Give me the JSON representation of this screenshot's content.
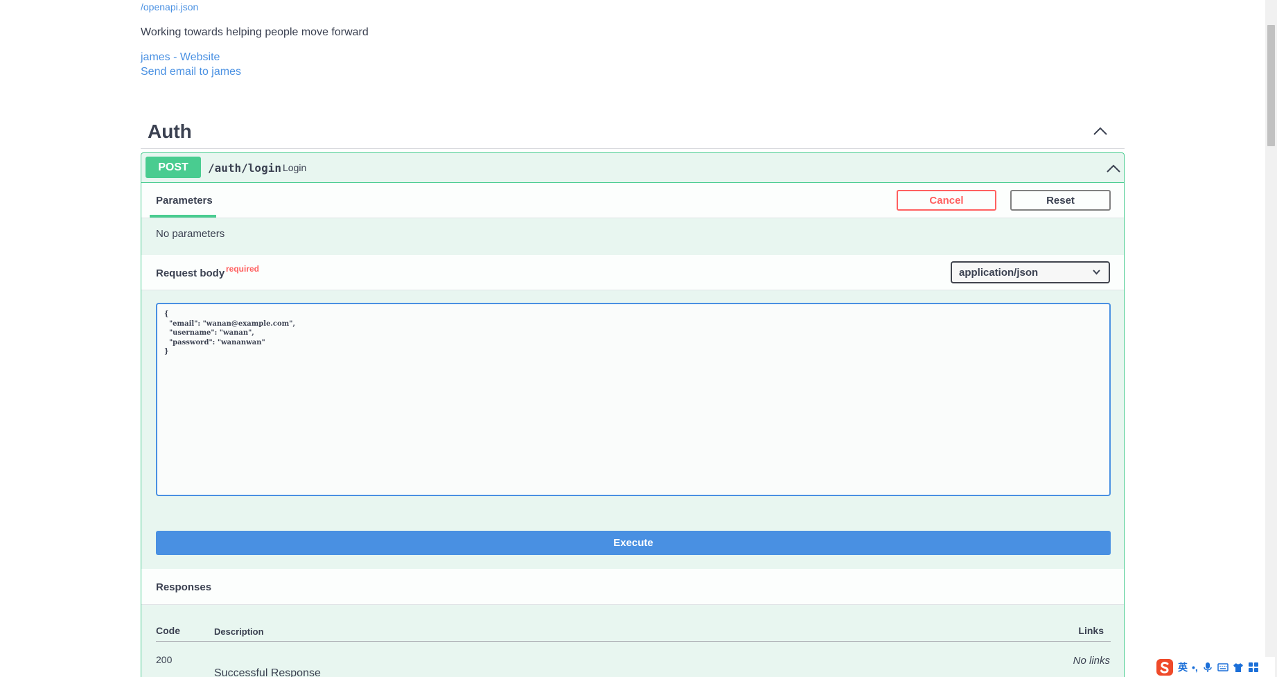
{
  "info": {
    "spec_url": "/openapi.json",
    "description": "Working towards helping people move forward",
    "website_link": "james - Website",
    "email_link": "Send email to james"
  },
  "tag": {
    "title": "Auth",
    "chevron_icon": "chevron-up-icon"
  },
  "operation": {
    "method": "POST",
    "path": "/auth/login",
    "summary": "Login",
    "chevron_icon": "chevron-up-icon",
    "parameters_tab": "Parameters",
    "cancel_label": "Cancel",
    "reset_label": "Reset",
    "no_parameters": "No parameters",
    "request_body_label": "Request body",
    "required_label": "required",
    "content_type": "application/json",
    "body": "{\n  \"email\": \"wanan@example.com\",\n  \"username\": \"wanan\",\n  \"password\": \"wananwan\"\n}",
    "execute_label": "Execute",
    "responses_label": "Responses",
    "responses_table": {
      "headers": {
        "code": "Code",
        "description": "Description",
        "links": "Links"
      },
      "rows": [
        {
          "code": "200",
          "description": "Successful Response",
          "links": "No links"
        }
      ]
    }
  },
  "ime": {
    "language": "英",
    "punct": "•,"
  },
  "colors": {
    "post": "#49cc90",
    "cancel": "#ff6060",
    "execute": "#4990e2",
    "link": "#4990e2"
  }
}
